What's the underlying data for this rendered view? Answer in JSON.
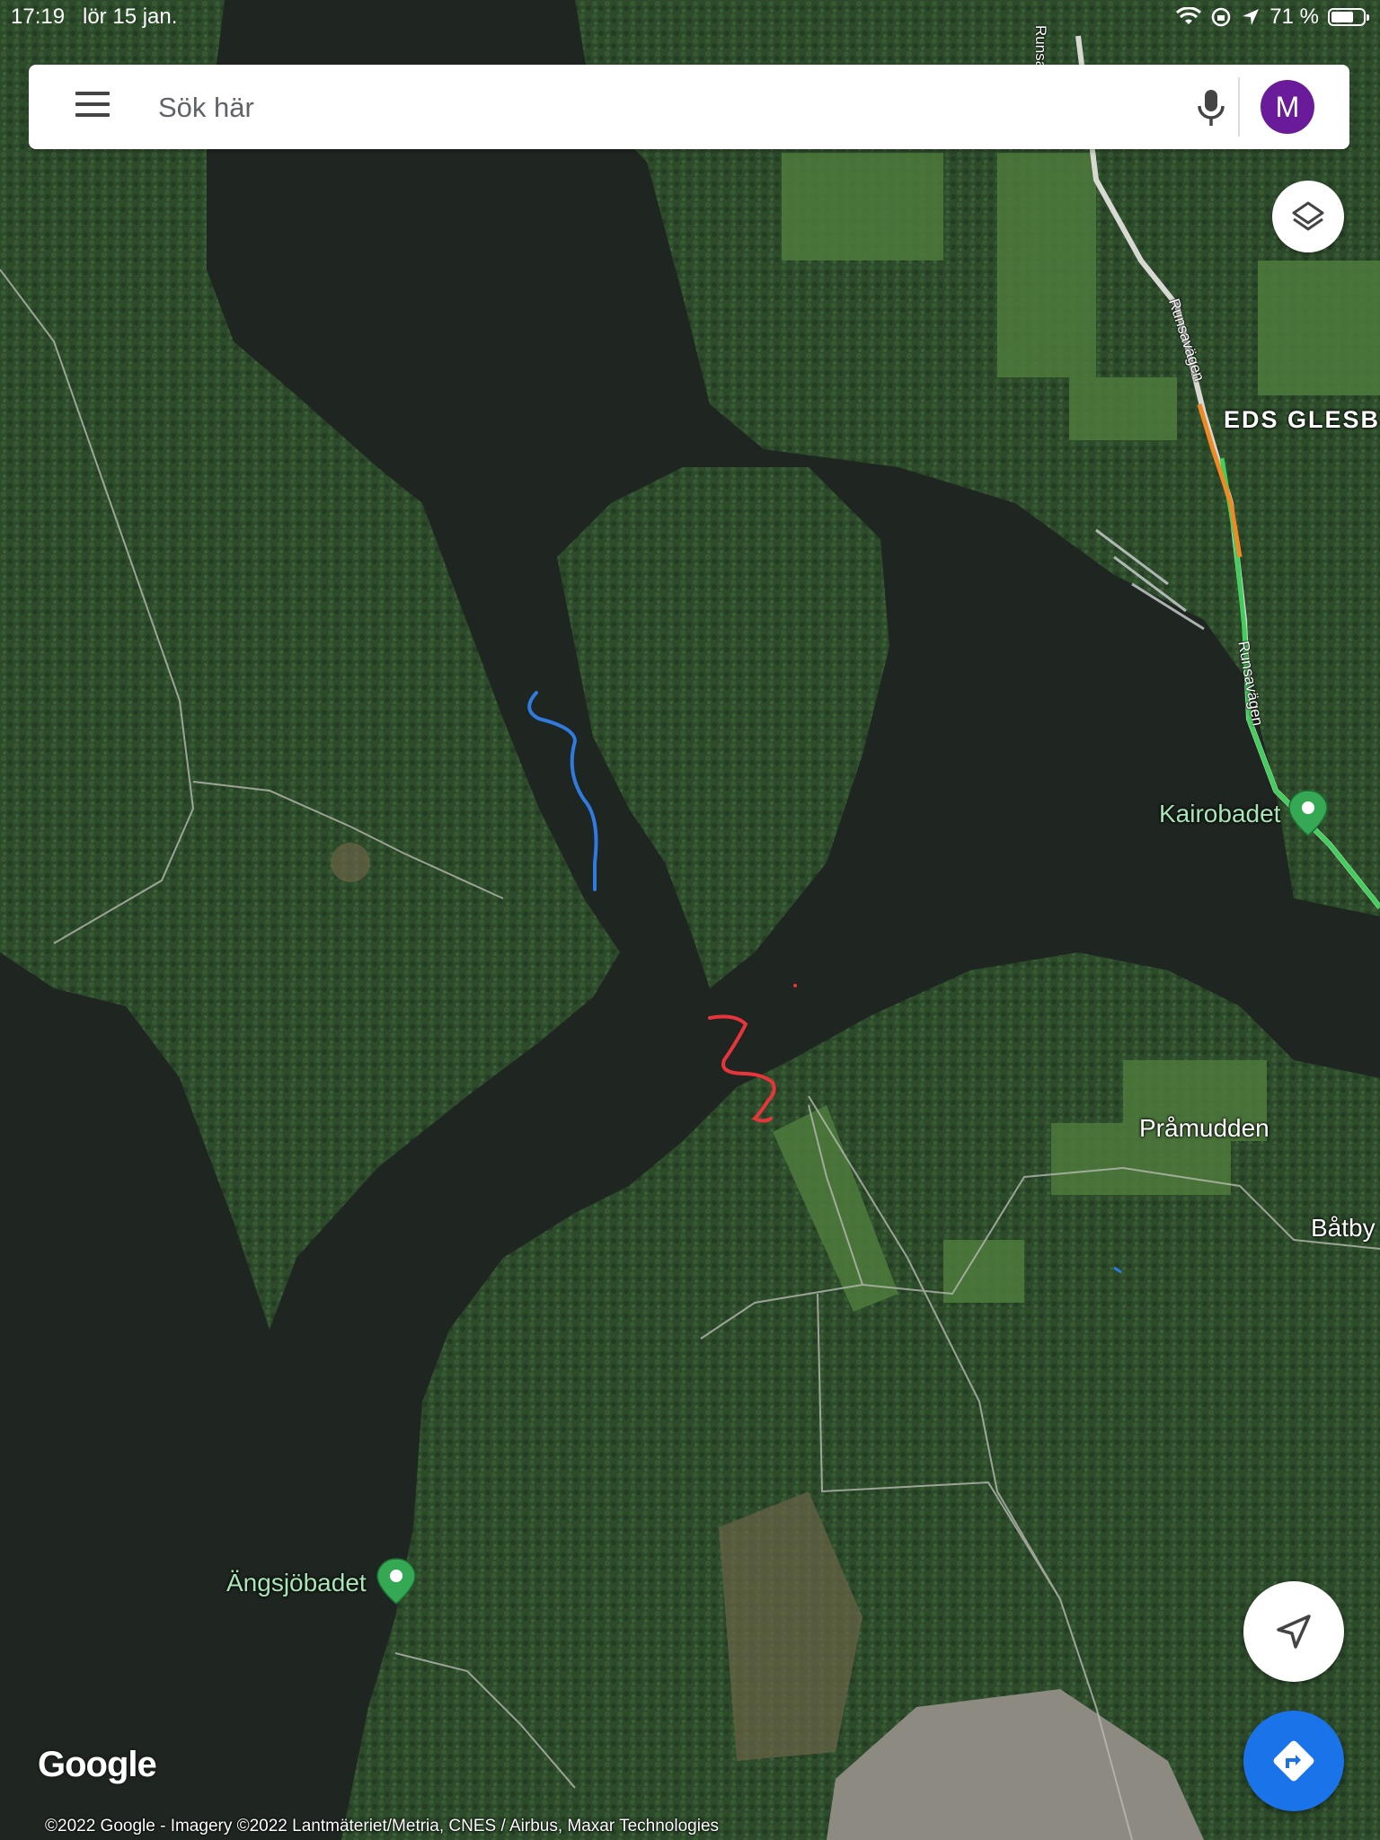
{
  "status_bar": {
    "time": "17:19",
    "date": "lör 15 jan.",
    "battery": "71 %",
    "battery_level": 0.71
  },
  "search": {
    "placeholder": "Sök här"
  },
  "account": {
    "initial": "M",
    "color": "#6a1b9a"
  },
  "colors": {
    "water": "#1f2521",
    "forest": "#2e4a2c",
    "field": "#4d7a3e",
    "blue_drawn_route": "#2f7be0",
    "red_drawn_route": "#e8343b",
    "poi_green": "#34a853",
    "directions_button": "#1a73e8",
    "road_traffic_green": "#3fcf5a",
    "road_traffic_orange": "#f08a24"
  },
  "map": {
    "type": "satellite",
    "labels": {
      "eds_glesby": "EDS GLESBY",
      "pramudden": "Pråmudden",
      "batby": "Båtby",
      "road_top": "Runsavägen",
      "road_middle": "Runsavägen",
      "road_lower": "Runsavägen"
    },
    "pois": [
      {
        "label": "Kairobadet",
        "icon": "beach-pin-icon"
      },
      {
        "label": "Ängsjöbadet",
        "icon": "beach-pin-icon"
      }
    ]
  },
  "controls": {
    "layers_icon": "layers-icon",
    "locate_icon": "navigation-arrow-icon",
    "directions_icon": "directions-icon"
  },
  "branding": {
    "logo": "Google",
    "copyright": "©2022 Google - Imagery ©2022 Lantmäteriet/Metria, CNES / Airbus, Maxar Technologies"
  }
}
